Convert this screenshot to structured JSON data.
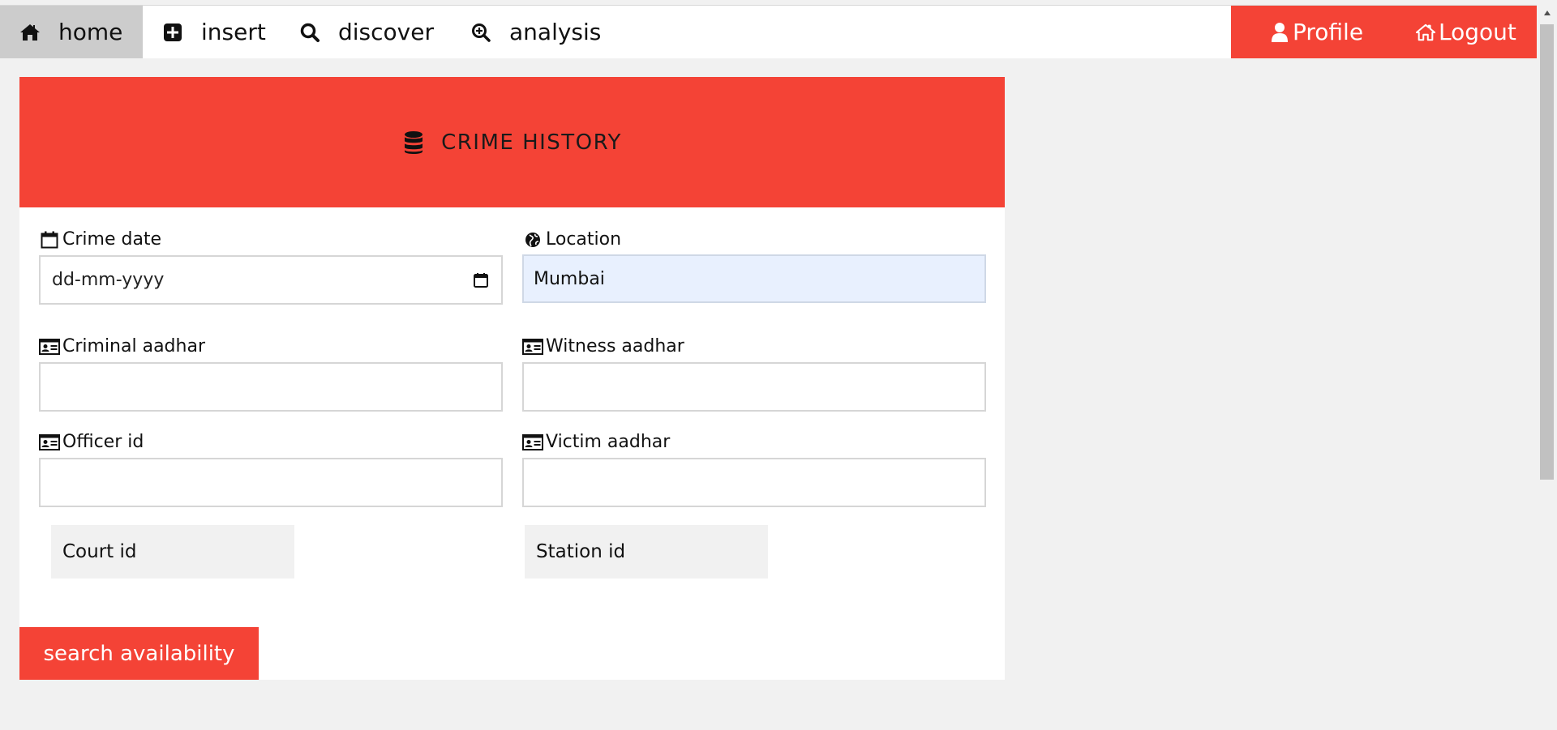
{
  "nav": {
    "home": {
      "label": "home",
      "icon": "home-icon"
    },
    "insert": {
      "label": "insert",
      "icon": "plus-square-icon"
    },
    "discover": {
      "label": "discover",
      "icon": "search-icon"
    },
    "analysis": {
      "label": "analysis",
      "icon": "zoom-in-icon"
    },
    "profile": {
      "label": "Profile",
      "icon": "user-icon"
    },
    "logout": {
      "label": "Logout",
      "icon": "home-icon"
    }
  },
  "card": {
    "title": "CRIME HISTORY",
    "title_icon": "database-icon"
  },
  "form": {
    "crime_date": {
      "label": "Crime date",
      "placeholder": "dd-mm-yyyy",
      "icon": "calendar-icon"
    },
    "location": {
      "label": "Location",
      "value": "Mumbai",
      "icon": "globe-icon"
    },
    "criminal_aadhar": {
      "label": "Criminal aadhar",
      "value": "",
      "icon": "id-card-icon"
    },
    "witness_aadhar": {
      "label": "Witness aadhar",
      "value": "",
      "icon": "id-card-icon"
    },
    "officer_id": {
      "label": "Officer id",
      "value": "",
      "icon": "id-card-icon"
    },
    "victim_aadhar": {
      "label": "Victim aadhar",
      "value": "",
      "icon": "id-card-icon"
    },
    "court_id": {
      "selected": "Court id"
    },
    "station_id": {
      "selected": "Station id"
    },
    "submit_label": "search availability"
  },
  "colors": {
    "accent": "#f44336",
    "page_bg": "#f1f1f1",
    "nav_active_bg": "#cccccc",
    "active_input_bg": "#e8f0fe"
  }
}
